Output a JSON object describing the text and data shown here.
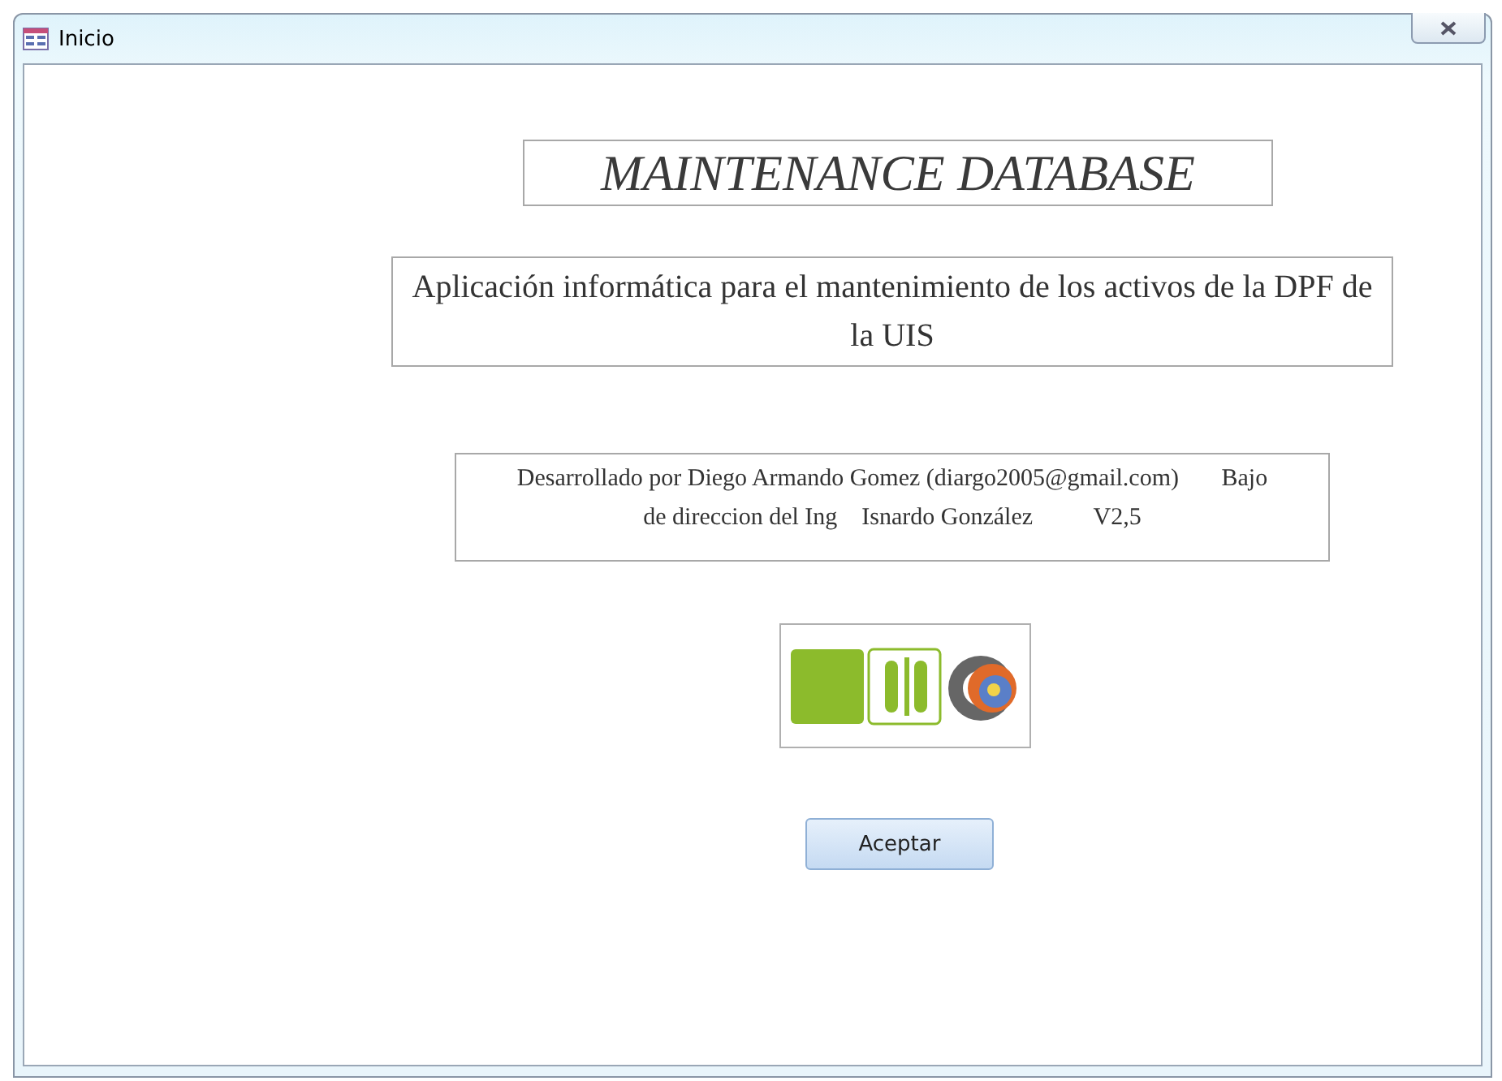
{
  "window": {
    "title": "Inicio"
  },
  "heading": "MAINTENANCE DATABASE",
  "subtitle": "Aplicación informática para el mantenimiento de los activos de la DPF de la UIS",
  "credits": {
    "line_1": "Desarrollado por Diego Armando Gomez (diargo2005@gmail.com)       Bajo",
    "line_2": "de direccion del Ing    Isnardo González          V2,5"
  },
  "buttons": [
    {
      "label": "Aceptar"
    }
  ]
}
